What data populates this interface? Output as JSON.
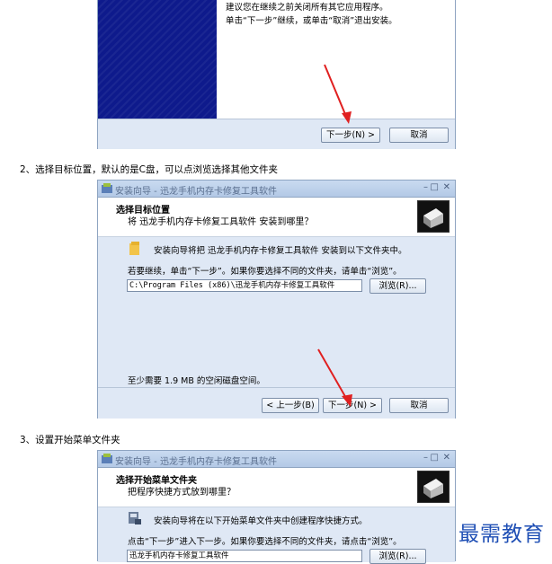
{
  "step1": {
    "line1": "建议您在继续之前关闭所有其它应用程序。",
    "line2": "单击“下一步”继续，或单击“取消”退出安装。",
    "next_button": "下一步(N) >",
    "cancel_button": "取消"
  },
  "caption2": "2、选择目标位置，默认的是C盘，可以点浏览选择其他文件夹",
  "step2": {
    "window_title": "安装向导 - 迅龙手机内存卡修复工具软件",
    "header_title": "选择目标位置",
    "header_subtitle": "将 迅龙手机内存卡修复工具软件 安装到哪里？",
    "info_line": "安装向导将把 迅龙手机内存卡修复工具软件 安装到以下文件夹中。",
    "continue_line": "若要继续，单击“下一步”。如果你要选择不同的文件夹，请单击“浏览”。",
    "path_value": "C:\\Program Files (x86)\\迅龙手机内存卡修复工具软件",
    "browse_button": "浏览(R)...",
    "space_line": "至少需要 1.9 MB 的空闲磁盘空间。",
    "back_button": "< 上一步(B)",
    "next_button": "下一步(N) >",
    "cancel_button": "取消"
  },
  "caption3": "3、设置开始菜单文件夹",
  "step3": {
    "window_title": "安装向导 - 迅龙手机内存卡修复工具软件",
    "header_title": "选择开始菜单文件夹",
    "header_subtitle": "把程序快捷方式放到哪里？",
    "info_line": "安装向导将在以下开始菜单文件夹中创建程序快捷方式。",
    "continue_line": "点击“下一步”进入下一步。如果你要选择不同的文件夹，请点击“浏览”。",
    "folder_value": "迅龙手机内存卡修复工具软件",
    "browse_button": "浏览(R)..."
  },
  "watermark": "最需教育",
  "colors": {
    "accent": "#1f4fb5",
    "arrow": "#e02020",
    "banner": "#0e1a8c"
  }
}
